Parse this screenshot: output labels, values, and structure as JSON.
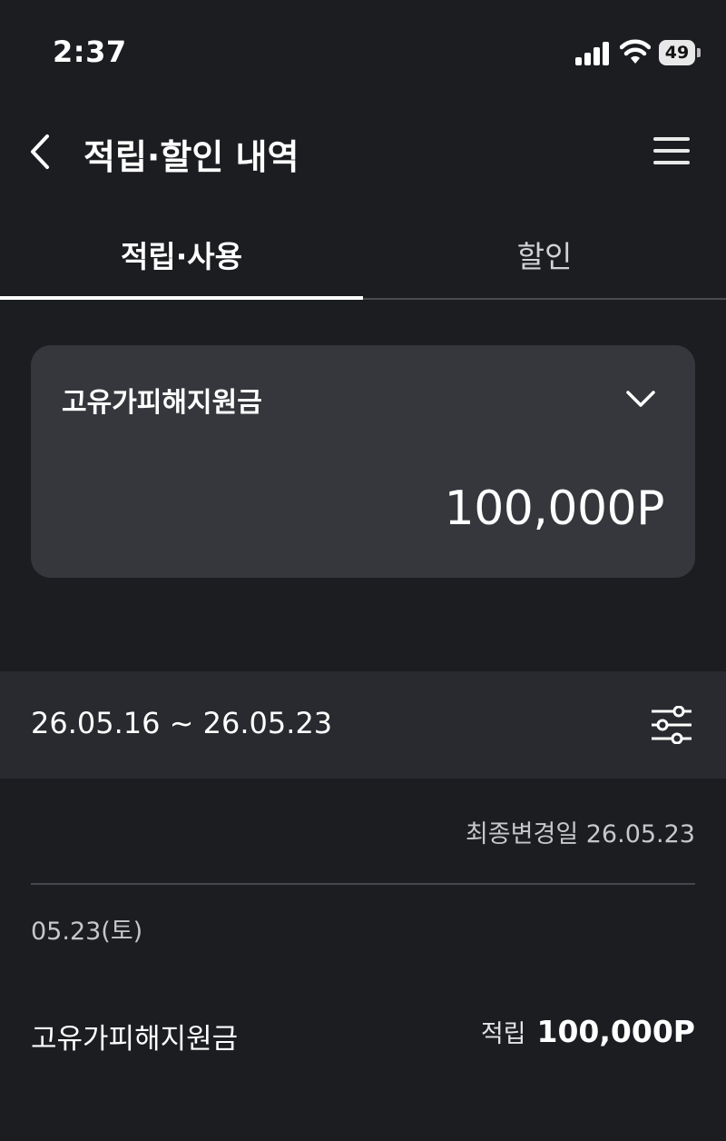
{
  "status_bar": {
    "time": "2:37",
    "battery": "49"
  },
  "header": {
    "title": "적립·할인 내역",
    "back_icon": "chevron-left-icon",
    "menu_icon": "hamburger-menu-icon"
  },
  "tabs": [
    {
      "label": "적립·사용",
      "active": true
    },
    {
      "label": "할인",
      "active": false
    }
  ],
  "point_card": {
    "selected_type": "고유가피해지원금",
    "amount": "100,000P"
  },
  "date_filter": {
    "range": "26.05.16 ~ 26.05.23",
    "filter_icon": "sliders-filter-icon"
  },
  "last_modified": "최종변경일 26.05.23",
  "history": [
    {
      "date": "05.23(토)",
      "items": [
        {
          "name": "고유가피해지원금",
          "type": "적립",
          "amount": "100,000P"
        }
      ]
    }
  ],
  "colors": {
    "background": "#1c1d21",
    "card": "#35373c",
    "filter_bar": "#292a2f",
    "text_primary": "#ffffff",
    "text_secondary": "#c7c7cb"
  }
}
